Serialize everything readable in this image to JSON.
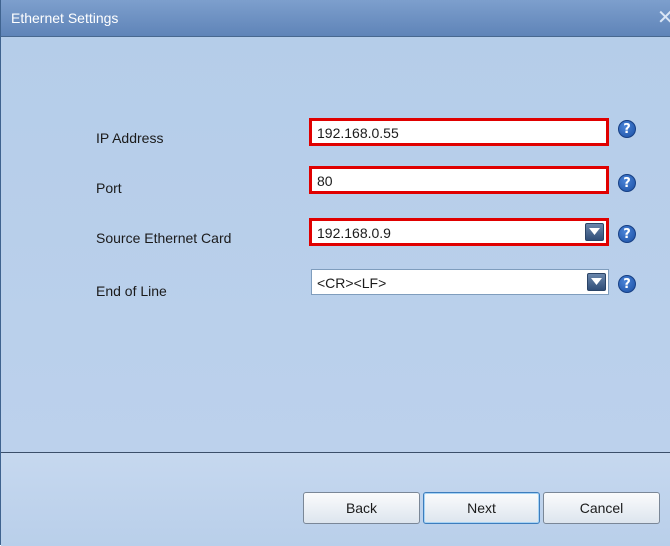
{
  "window": {
    "title": "Ethernet Settings",
    "close_glyph": "✕"
  },
  "form": {
    "ip_address": {
      "label": "IP Address",
      "value": "192.168.0.55"
    },
    "port": {
      "label": "Port",
      "value": "80"
    },
    "source_card": {
      "label": "Source Ethernet Card",
      "value": "192.168.0.9"
    },
    "end_of_line": {
      "label": "End of Line",
      "value": "<CR><LF>"
    },
    "help_glyph": "?"
  },
  "buttons": {
    "back": "Back",
    "next": "Next",
    "cancel": "Cancel"
  },
  "colors": {
    "highlight_border": "#e00000",
    "window_background": "#b5cde9",
    "title_bar": "#6a8ec1",
    "help_icon": "#1b4fa3"
  }
}
